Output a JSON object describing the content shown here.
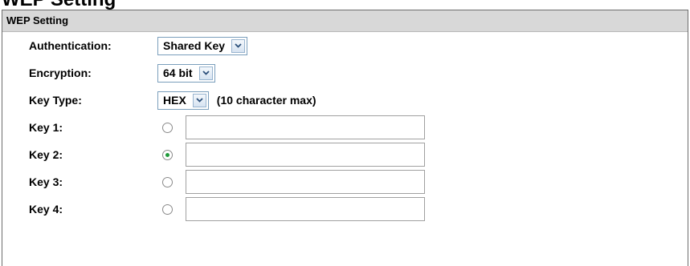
{
  "page": {
    "title": "WEP Setting"
  },
  "panel": {
    "header": "WEP Setting"
  },
  "authentication": {
    "label": "Authentication:",
    "value": "Shared Key"
  },
  "encryption": {
    "label": "Encryption:",
    "value": "64 bit"
  },
  "key_type": {
    "label": "Key Type:",
    "value": "HEX",
    "hint": "(10 character max)"
  },
  "keys": [
    {
      "label": "Key 1:",
      "selected": false,
      "value": ""
    },
    {
      "label": "Key 2:",
      "selected": true,
      "value": ""
    },
    {
      "label": "Key 3:",
      "selected": false,
      "value": ""
    },
    {
      "label": "Key 4:",
      "selected": false,
      "value": ""
    }
  ],
  "colors": {
    "header_bg": "#d8d8d8",
    "border": "#6e6e6e",
    "radio_selected": "#1f9a3a",
    "select_border": "#7a9ebc"
  },
  "icons": {
    "dropdown": "chevron-down-icon"
  }
}
